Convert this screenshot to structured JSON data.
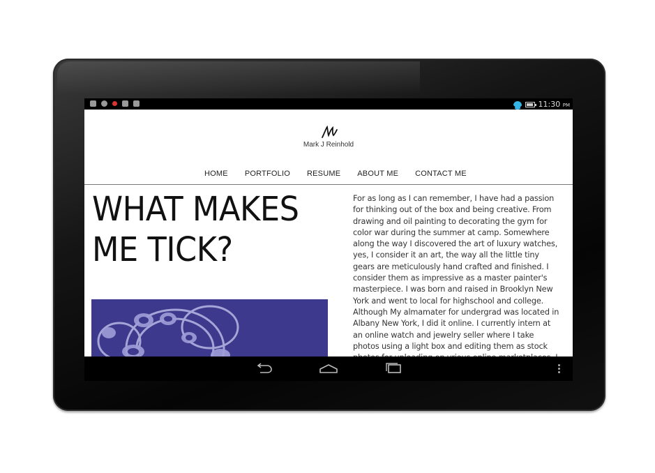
{
  "status_bar": {
    "time": "11:30",
    "ampm": "PM",
    "left_icons": [
      "image-icon",
      "chat-icon",
      "record-icon",
      "check-icon",
      "download-icon"
    ],
    "accent": "#35b5e5"
  },
  "site": {
    "logo_name": "Mark J Reinhold",
    "nav": [
      "HOME",
      "PORTFOLIO",
      "RESUME",
      "ABOUT ME",
      "CONTACT ME"
    ]
  },
  "content": {
    "headline": "WHAT MAKES ME TICK?",
    "body": "For as long as I can remember, I have had a passion for thinking out of the box and being creative. From drawing and oil painting to decorating the gym for color war during the summer at camp. Somewhere along the way I discovered the art of luxury watches, yes, I consider it an art, the way all the little tiny gears are meticulously hand crafted and finished. I consider them as impressive as a master painter's masterpiece. I was born and raised in Brooklyn New York and went to local for highschool and college. Although My almamater for undergrad was located in Albany New York, I did it online. I currently intern at an online watch and jewelry seller where I take photos using a light box and editing them as stock photos for uploading on vrious online marketplaces. I used to intern for a marketing and advertising company called",
    "photo_color": "#3d3a8d"
  },
  "system_nav": {
    "buttons": [
      "back-icon",
      "home-icon",
      "recents-icon",
      "menu-icon"
    ]
  }
}
